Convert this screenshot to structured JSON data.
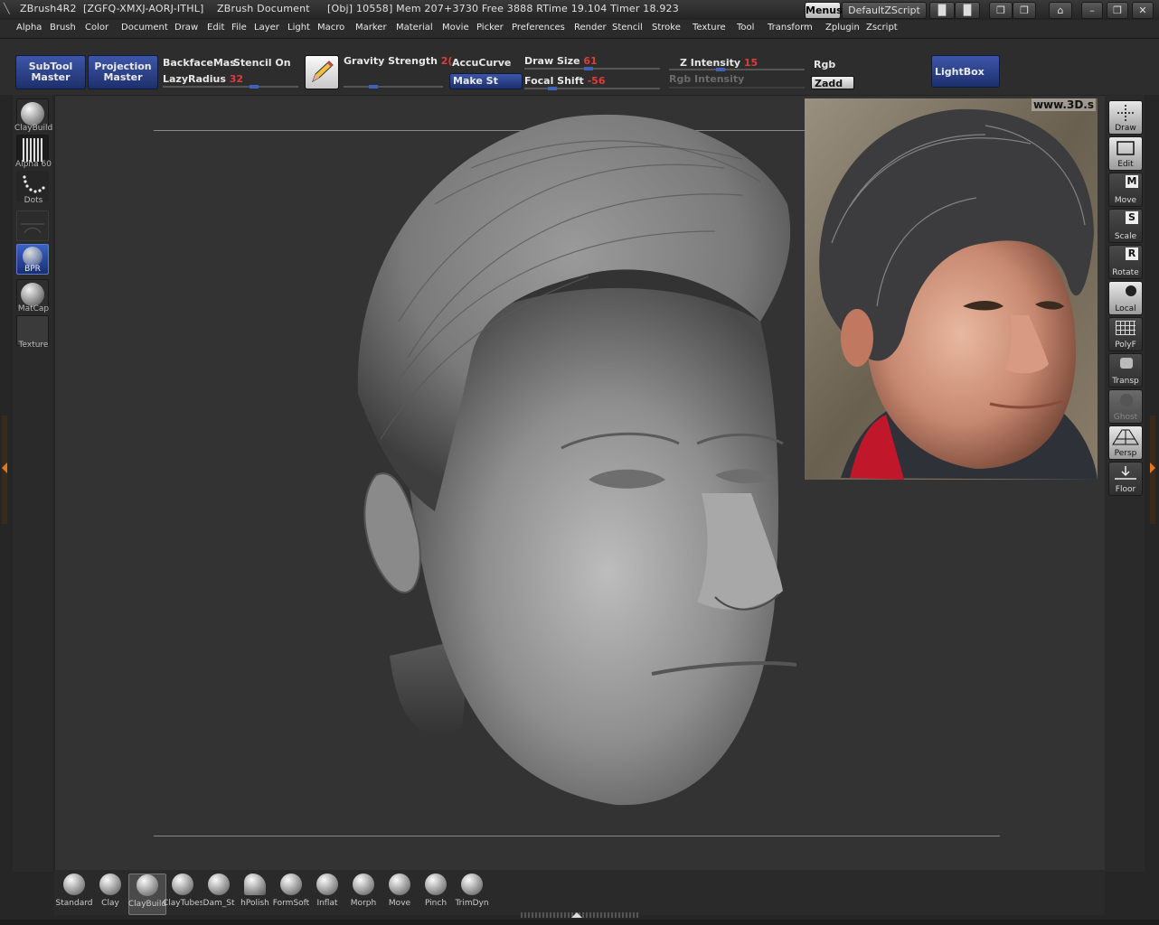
{
  "titlebar": {
    "app": "ZBrush4R2",
    "key": "[ZGFQ-XMXJ-AORJ-ITHL]",
    "document": "ZBrush Document",
    "stats": "[Obj] 10558] Mem 207+3730 Free 3888 RTime 19.104 Timer 18.923",
    "menus_button": "Menus",
    "script_button": "DefaultZScript"
  },
  "menubar": [
    "Alpha",
    "Brush",
    "Color",
    "Document",
    "Draw",
    "Edit",
    "File",
    "Layer",
    "Light",
    "Macro",
    "Marker",
    "Material",
    "Movie",
    "Picker",
    "Preferences",
    "Render",
    "Stencil",
    "Stroke",
    "Texture",
    "Tool",
    "Transform",
    "Zplugin",
    "Zscript"
  ],
  "shelf": {
    "subtool_master": [
      "SubTool",
      "Master"
    ],
    "projection_master": [
      "Projection",
      "Master"
    ],
    "backface": "BackfaceMas",
    "stencil_on": "Stencil On",
    "lazy_radius_label": "LazyRadius",
    "lazy_radius_value": "32",
    "gravity_label": "Gravity Strength",
    "gravity_value": "2(",
    "accucurve": "AccuCurve",
    "make_st": "Make St",
    "draw_size_label": "Draw Size",
    "draw_size_value": "61",
    "focal_shift_label": "Focal Shift",
    "focal_shift_value": "-56",
    "z_intensity_label": "Z Intensity",
    "z_intensity_value": "15",
    "rgb_intensity_label": "Rgb Intensity",
    "rgb": "Rgb",
    "zadd": "Zadd",
    "lightbox": "LightBox"
  },
  "lefttray": [
    "ClayBuild",
    "Alpha  60",
    "Dots",
    "",
    "BPR",
    "MatCap",
    "Texture"
  ],
  "reference_watermark": "www.3D.s",
  "rightshelf": [
    "Draw",
    "Edit",
    "Move",
    "Scale",
    "Rotate",
    "Local",
    "PolyF",
    "Transp",
    "Ghost",
    "Persp",
    "Floor"
  ],
  "bottom_brushes": [
    "Standard",
    "Clay",
    "ClayBuild",
    "ClayTubes",
    "Dam_St",
    "hPolish",
    "FormSoft",
    "Inflat",
    "Morph",
    "Move",
    "Pinch",
    "TrimDyn"
  ],
  "colors": {
    "accent_blue": "#2c4590",
    "value_red": "#e23a3a",
    "canvas": "#333333"
  }
}
